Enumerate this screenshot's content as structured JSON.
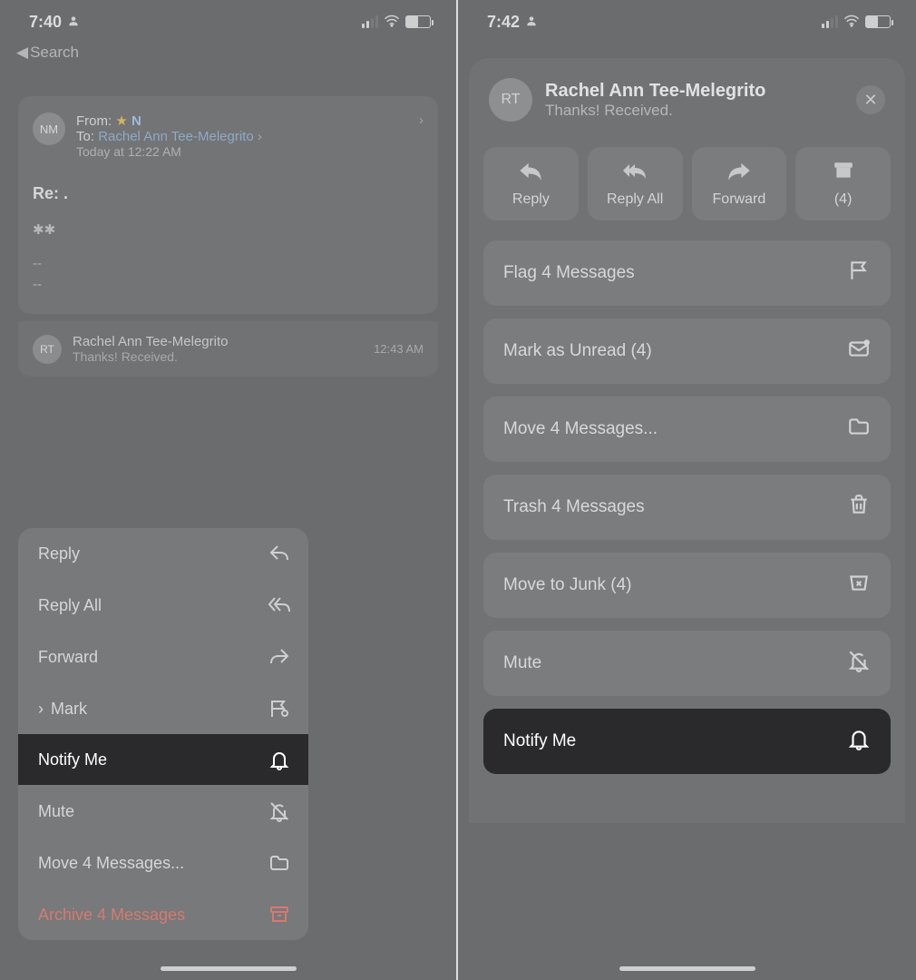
{
  "left": {
    "status_time": "7:40",
    "back_label": "Search",
    "email": {
      "avatar_initials": "NM",
      "from_label": "From:",
      "from_name": "N",
      "to_label": "To:",
      "to_name": "Rachel Ann Tee-Melegrito",
      "date_line": "Today at 12:22 AM",
      "subject": "Re: ."
    },
    "thread": {
      "avatar_initials": "RT",
      "name": "Rachel Ann Tee-Melegrito",
      "snippet": "Thanks! Received.",
      "time": "12:43 AM"
    },
    "menu": {
      "reply": "Reply",
      "reply_all": "Reply All",
      "forward": "Forward",
      "mark": "Mark",
      "notify": "Notify Me",
      "mute": "Mute",
      "move": "Move 4 Messages...",
      "archive": "Archive 4 Messages"
    }
  },
  "right": {
    "status_time": "7:42",
    "header": {
      "avatar_initials": "RT",
      "name": "Rachel Ann Tee-Melegrito",
      "subtitle": "Thanks! Received."
    },
    "top_actions": {
      "reply": "Reply",
      "reply_all": "Reply All",
      "forward": "Forward",
      "archive_count": "(4)"
    },
    "actions": {
      "flag": "Flag 4 Messages",
      "mark_unread": "Mark as Unread (4)",
      "move": "Move 4 Messages...",
      "trash": "Trash 4 Messages",
      "junk": "Move to Junk (4)",
      "mute": "Mute",
      "notify": "Notify Me"
    }
  }
}
